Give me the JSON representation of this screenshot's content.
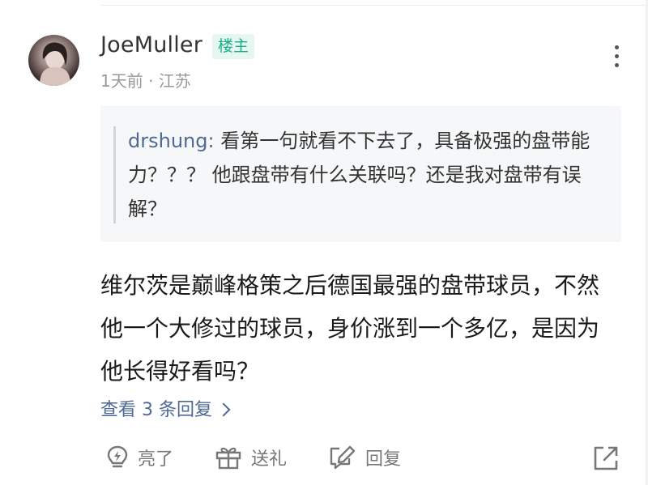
{
  "comment": {
    "author": "JoeMuller",
    "badge": "楼主",
    "time_location": "1天前 · 江苏",
    "quote": {
      "author": "drshung:",
      "text": " 看第一句就看不下去了，具备极强的盘带能力？？？ 他跟盘带有什么关联吗？还是我对盘带有误解？"
    },
    "body": "维尔茨是巅峰格策之后德国最强的盘带球员，不然他一个大修过的球员，身价涨到一个多亿，是因为他长得好看吗？",
    "replies_link": "查看 3 条回复"
  },
  "actions": {
    "like_label": "亮了",
    "gift_label": "送礼",
    "reply_label": "回复"
  },
  "icons": [
    "avatar",
    "more-icon",
    "lightbulb-icon",
    "gift-icon",
    "edit-icon",
    "share-icon",
    "chevron-right-icon"
  ],
  "colors": {
    "badge_text": "#1aad8a",
    "badge_bg": "#e6f6f1",
    "link": "#4d6a94",
    "quote_bg": "#f6f7f8"
  }
}
